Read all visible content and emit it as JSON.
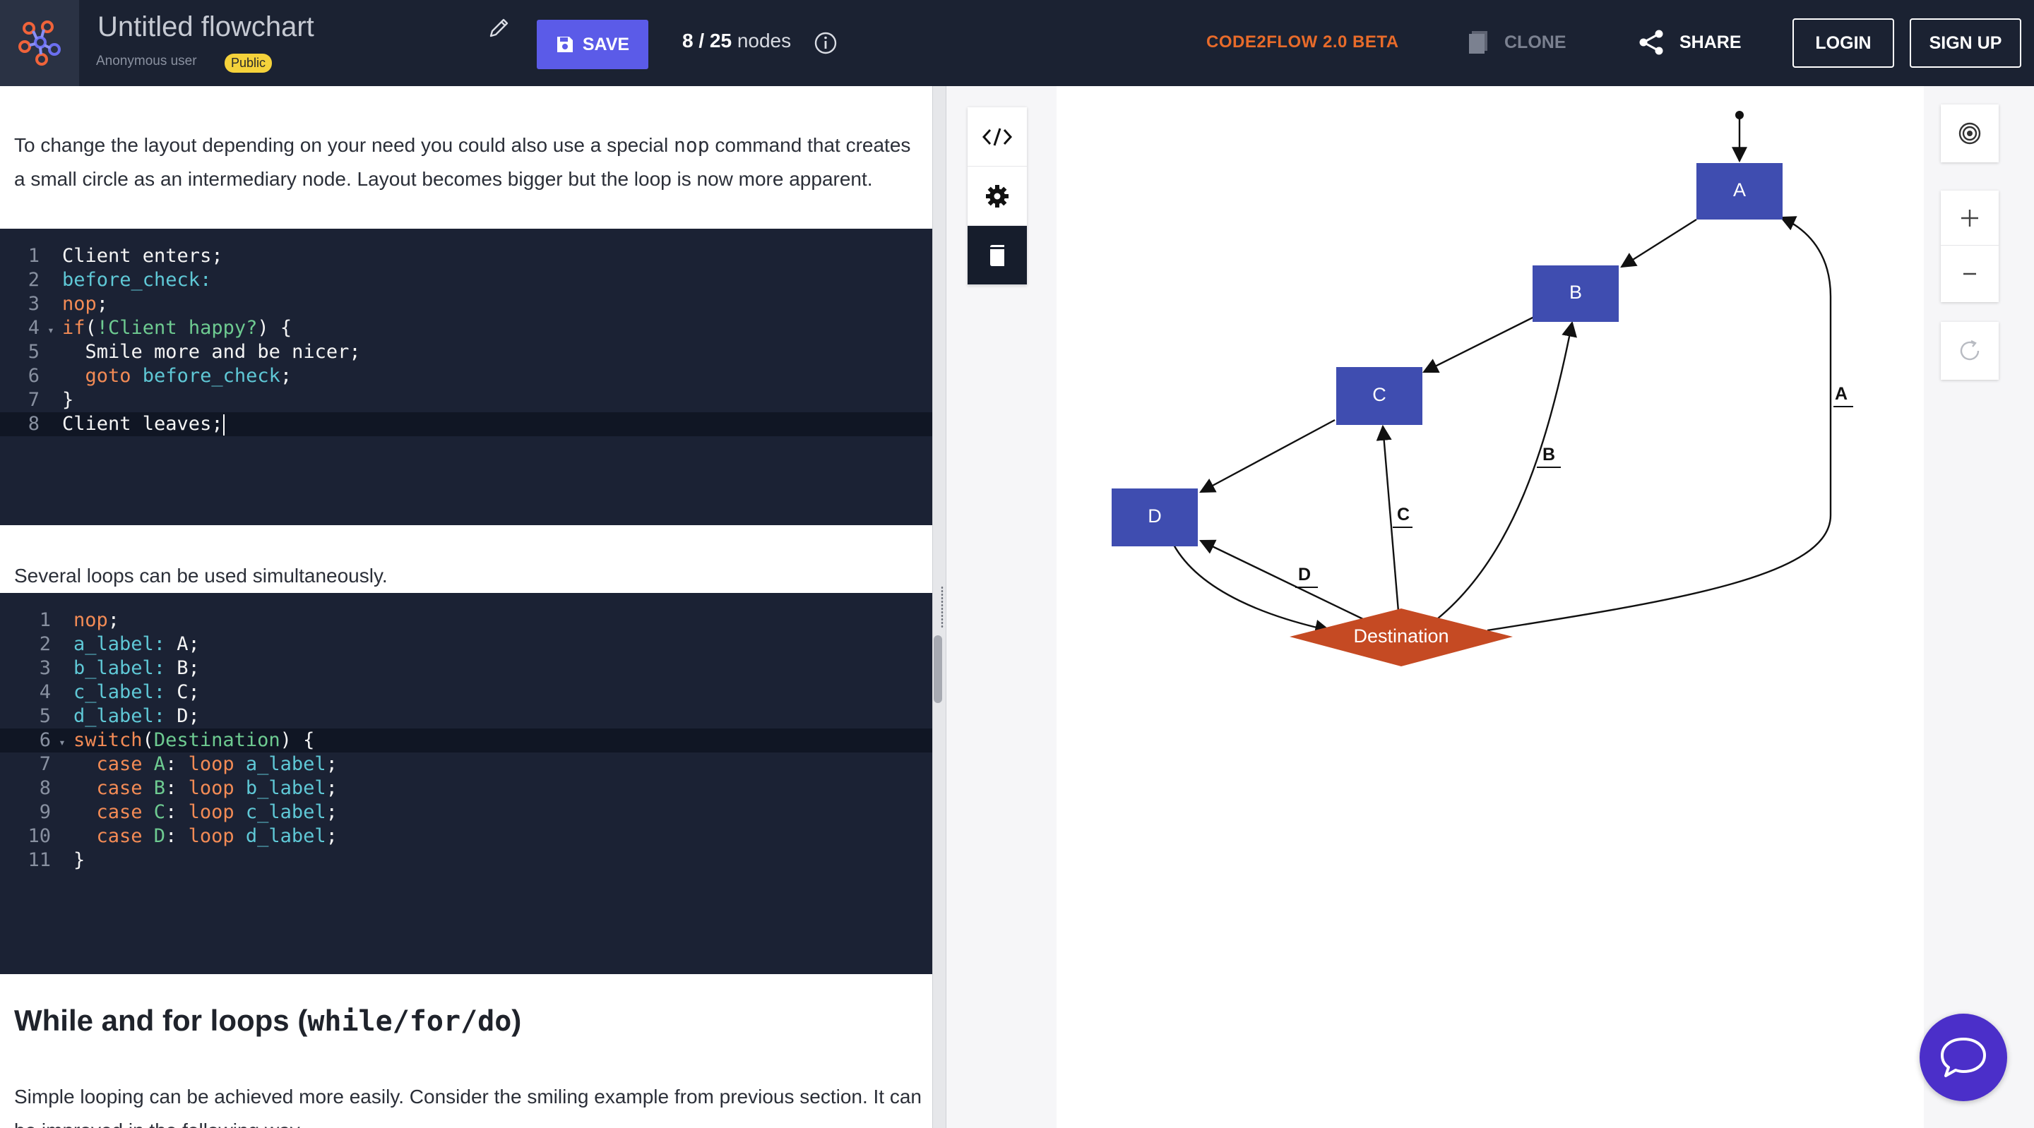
{
  "header": {
    "title": "Untitled flowchart",
    "user": "Anonymous user",
    "visibility": "Public",
    "save_label": "SAVE",
    "nodes_used": "8 / 25",
    "nodes_word": "nodes",
    "brand": "CODE2FLOW 2.0 BETA",
    "clone_label": "CLONE",
    "share_label": "SHARE",
    "login_label": "LOGIN",
    "signup_label": "SIGN UP"
  },
  "doc": {
    "para1_a": "To change the layout depending on your need you could also use a special ",
    "para1_code": "nop",
    "para1_b": " command that creates a small circle as an intermediary node. Layout becomes bigger but the loop is now more apparent.",
    "para2": "Several loops can be used simultaneously.",
    "heading_a": "While and for loops (",
    "heading_code": "while/for/do",
    "heading_b": ")",
    "para3": "Simple looping can be achieved more easily. Consider the smiling example from previous section. It can be improved in the following way."
  },
  "code1": {
    "lines": [
      {
        "n": "1",
        "fold": "",
        "tokens": [
          {
            "t": "Client enters;",
            "c": "w"
          }
        ]
      },
      {
        "n": "2",
        "fold": "",
        "tokens": [
          {
            "t": "before_check:",
            "c": "t"
          }
        ]
      },
      {
        "n": "3",
        "fold": "",
        "tokens": [
          {
            "t": "nop",
            "c": "o"
          },
          {
            "t": ";",
            "c": "w"
          }
        ]
      },
      {
        "n": "4",
        "fold": "▾",
        "tokens": [
          {
            "t": "if",
            "c": "o"
          },
          {
            "t": "(",
            "c": "w"
          },
          {
            "t": "!Client happy?",
            "c": "g"
          },
          {
            "t": ") {",
            "c": "w"
          }
        ]
      },
      {
        "n": "5",
        "fold": "",
        "tokens": [
          {
            "t": "  Smile more and be nicer;",
            "c": "w"
          }
        ]
      },
      {
        "n": "6",
        "fold": "",
        "tokens": [
          {
            "t": "  ",
            "c": "w"
          },
          {
            "t": "goto",
            "c": "o"
          },
          {
            "t": " before_check",
            "c": "t"
          },
          {
            "t": ";",
            "c": "w"
          }
        ]
      },
      {
        "n": "7",
        "fold": "",
        "tokens": [
          {
            "t": "}",
            "c": "w"
          }
        ]
      },
      {
        "n": "8",
        "fold": "",
        "active": true,
        "cursor": true,
        "tokens": [
          {
            "t": "Client leaves;",
            "c": "w"
          }
        ]
      }
    ]
  },
  "code2": {
    "lines": [
      {
        "n": "1",
        "fold": "",
        "tokens": [
          {
            "t": "nop",
            "c": "o"
          },
          {
            "t": ";",
            "c": "w"
          }
        ]
      },
      {
        "n": "2",
        "fold": "",
        "tokens": [
          {
            "t": "a_label:",
            "c": "t"
          },
          {
            "t": " A;",
            "c": "w"
          }
        ]
      },
      {
        "n": "3",
        "fold": "",
        "tokens": [
          {
            "t": "b_label:",
            "c": "t"
          },
          {
            "t": " B;",
            "c": "w"
          }
        ]
      },
      {
        "n": "4",
        "fold": "",
        "tokens": [
          {
            "t": "c_label:",
            "c": "t"
          },
          {
            "t": " C;",
            "c": "w"
          }
        ]
      },
      {
        "n": "5",
        "fold": "",
        "tokens": [
          {
            "t": "d_label:",
            "c": "t"
          },
          {
            "t": " D;",
            "c": "w"
          }
        ]
      },
      {
        "n": "6",
        "fold": "▾",
        "active": true,
        "tokens": [
          {
            "t": "switch",
            "c": "o"
          },
          {
            "t": "(",
            "c": "w"
          },
          {
            "t": "Destination",
            "c": "g"
          },
          {
            "t": ") {",
            "c": "w"
          }
        ]
      },
      {
        "n": "7",
        "fold": "",
        "tokens": [
          {
            "t": "  ",
            "c": "w"
          },
          {
            "t": "case",
            "c": "o"
          },
          {
            "t": " A",
            "c": "g"
          },
          {
            "t": ": ",
            "c": "w"
          },
          {
            "t": "loop",
            "c": "o"
          },
          {
            "t": " a_label",
            "c": "t"
          },
          {
            "t": ";",
            "c": "w"
          }
        ]
      },
      {
        "n": "8",
        "fold": "",
        "tokens": [
          {
            "t": "  ",
            "c": "w"
          },
          {
            "t": "case",
            "c": "o"
          },
          {
            "t": " B",
            "c": "g"
          },
          {
            "t": ": ",
            "c": "w"
          },
          {
            "t": "loop",
            "c": "o"
          },
          {
            "t": " b_label",
            "c": "t"
          },
          {
            "t": ";",
            "c": "w"
          }
        ]
      },
      {
        "n": "9",
        "fold": "",
        "tokens": [
          {
            "t": "  ",
            "c": "w"
          },
          {
            "t": "case",
            "c": "o"
          },
          {
            "t": " C",
            "c": "g"
          },
          {
            "t": ": ",
            "c": "w"
          },
          {
            "t": "loop",
            "c": "o"
          },
          {
            "t": " c_label",
            "c": "t"
          },
          {
            "t": ";",
            "c": "w"
          }
        ]
      },
      {
        "n": "10",
        "fold": "",
        "tokens": [
          {
            "t": "  ",
            "c": "w"
          },
          {
            "t": "case",
            "c": "o"
          },
          {
            "t": " D",
            "c": "g"
          },
          {
            "t": ": ",
            "c": "w"
          },
          {
            "t": "loop",
            "c": "o"
          },
          {
            "t": " d_label",
            "c": "t"
          },
          {
            "t": ";",
            "c": "w"
          }
        ]
      },
      {
        "n": "11",
        "fold": "",
        "tokens": [
          {
            "t": "}",
            "c": "w"
          }
        ]
      }
    ]
  },
  "flow": {
    "nodes": [
      {
        "id": "A",
        "label": "A",
        "shape": "rect"
      },
      {
        "id": "B",
        "label": "B",
        "shape": "rect"
      },
      {
        "id": "C",
        "label": "C",
        "shape": "rect"
      },
      {
        "id": "D",
        "label": "D",
        "shape": "rect"
      },
      {
        "id": "dest",
        "label": "Destination",
        "shape": "diamond"
      }
    ],
    "edges": [
      {
        "from": "start",
        "to": "A",
        "label": ""
      },
      {
        "from": "A",
        "to": "B",
        "label": ""
      },
      {
        "from": "B",
        "to": "C",
        "label": ""
      },
      {
        "from": "C",
        "to": "D",
        "label": ""
      },
      {
        "from": "D",
        "to": "dest",
        "label": ""
      },
      {
        "from": "dest",
        "to": "A",
        "label": "A"
      },
      {
        "from": "dest",
        "to": "B",
        "label": "B"
      },
      {
        "from": "dest",
        "to": "C",
        "label": "C"
      },
      {
        "from": "dest",
        "to": "D",
        "label": "D"
      }
    ]
  },
  "icons": {
    "logo": "flowchart-logo-icon",
    "edit": "pencil-icon",
    "save": "floppy-disk-icon",
    "info": "info-icon",
    "clone": "copy-icon",
    "share": "share-icon",
    "code": "code-icon",
    "settings": "gear-icon",
    "docs": "book-icon",
    "fit": "target-icon",
    "reset": "refresh-icon",
    "chat": "chat-bubble-icon"
  },
  "colors": {
    "header_bg": "#1b2232",
    "accent": "#5b5be8",
    "brand": "#e86b2a",
    "node": "#3f4db0",
    "decision": "#c54a23",
    "chat": "#4b2fc9"
  }
}
